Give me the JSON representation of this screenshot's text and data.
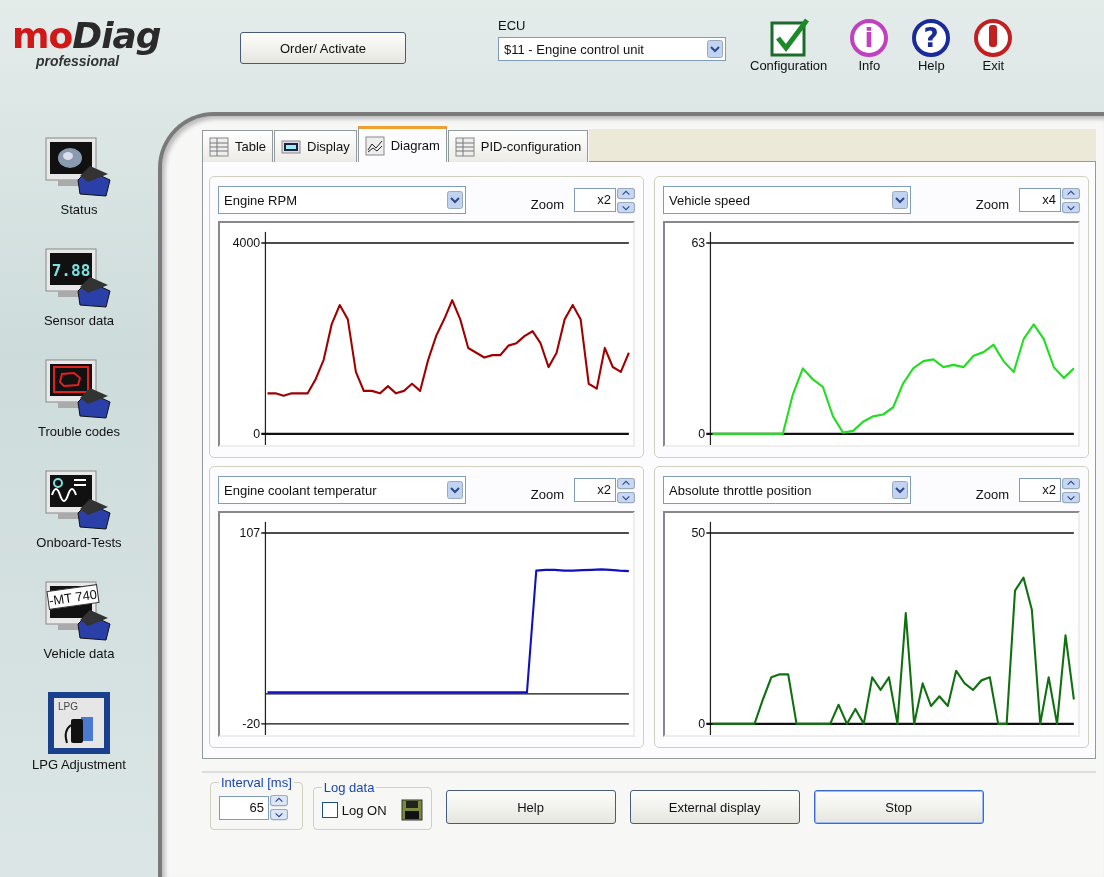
{
  "logo": {
    "brand_a": "mo",
    "brand_b": "Diag",
    "subtitle": "professional"
  },
  "header": {
    "order_button": "Order/ Activate",
    "ecu_label": "ECU",
    "ecu_value": "$11 - Engine control unit",
    "tools": [
      {
        "kind": "config",
        "label": "Configuration"
      },
      {
        "kind": "info",
        "label": "Info",
        "glyph": "i"
      },
      {
        "kind": "help",
        "label": "Help",
        "glyph": "?"
      },
      {
        "kind": "exit",
        "label": "Exit"
      }
    ]
  },
  "sidebar": {
    "items": [
      {
        "kind": "status",
        "label": "Status"
      },
      {
        "kind": "sensor",
        "label": "Sensor data",
        "screen_text": "7.88"
      },
      {
        "kind": "trouble",
        "label": "Trouble codes"
      },
      {
        "kind": "onboard",
        "label": "Onboard-Tests"
      },
      {
        "kind": "vehicle",
        "label": "Vehicle data",
        "screen_text": "-MT 740"
      },
      {
        "kind": "lpg",
        "label": "LPG Adjustment",
        "screen_text": "LPG"
      }
    ]
  },
  "tabs": [
    {
      "kind": "table",
      "label": "Table",
      "selected": false
    },
    {
      "kind": "display",
      "label": "Display",
      "selected": false
    },
    {
      "kind": "diagram",
      "label": "Diagram",
      "selected": true
    },
    {
      "kind": "table",
      "label": "PID-configuration",
      "selected": false
    }
  ],
  "diagrams": [
    {
      "parameter": "Engine RPM",
      "zoom_label": "Zoom",
      "zoom": "x2",
      "chart_data": {
        "type": "line",
        "ylim": [
          0,
          4000
        ],
        "yticks": [
          0,
          4000
        ],
        "series": [
          {
            "color": "#a00000",
            "values": [
              850,
              850,
              800,
              850,
              850,
              850,
              1150,
              1550,
              2300,
              2700,
              2400,
              1300,
              900,
              900,
              850,
              1000,
              850,
              900,
              1050,
              900,
              1550,
              2050,
              2400,
              2800,
              2400,
              1800,
              1700,
              1600,
              1650,
              1650,
              1850,
              1900,
              2050,
              2150,
              1900,
              1400,
              1700,
              2400,
              2700,
              2400,
              1050,
              950,
              1800,
              1400,
              1300,
              1700
            ]
          }
        ]
      }
    },
    {
      "parameter": "Vehicle speed",
      "zoom_label": "Zoom",
      "zoom": "x4",
      "chart_data": {
        "type": "line",
        "ylim": [
          0,
          63
        ],
        "yticks": [
          0,
          63
        ],
        "series": [
          {
            "color": "#22dd22",
            "values": [
              0,
              0,
              0,
              0,
              0,
              0,
              0,
              0,
              13,
              21.6,
              18,
              15.5,
              5.8,
              0.4,
              1,
              4,
              5.8,
              6.4,
              8.8,
              16.7,
              21.6,
              24,
              24.6,
              22,
              22.8,
              22,
              25.8,
              27,
              29.4,
              24,
              20.4,
              31.3,
              36.1,
              31.3,
              22,
              18.5,
              21.6
            ]
          }
        ]
      }
    },
    {
      "parameter": "Engine coolant temperatur",
      "zoom_label": "Zoom",
      "zoom": "x2",
      "chart_data": {
        "type": "line",
        "ylim": [
          -20,
          107
        ],
        "yticks": [
          -20,
          107
        ],
        "series": [
          {
            "color": "#1010c0",
            "values": [
              1,
              1,
              1,
              1,
              1,
              1,
              1,
              1,
              1,
              1,
              1,
              1,
              1,
              1,
              1,
              1,
              1,
              1,
              1,
              1,
              1,
              1,
              1,
              1,
              1,
              1,
              1,
              1,
              1,
              82,
              82.5,
              82.5,
              82,
              82,
              82.3,
              82.5,
              82.8,
              82.5,
              82,
              81.6
            ]
          }
        ]
      }
    },
    {
      "parameter": "Absolute throttle position",
      "zoom_label": "Zoom",
      "zoom": "x2",
      "chart_data": {
        "type": "line",
        "ylim": [
          0,
          50
        ],
        "yticks": [
          0,
          50
        ],
        "series": [
          {
            "color": "#107010",
            "values": [
              0,
              0,
              0,
              0,
              0,
              0,
              6.4,
              12.2,
              13,
              13,
              0,
              0,
              0,
              0,
              0,
              5,
              0,
              3.9,
              0,
              12.2,
              8.9,
              12.2,
              0,
              29,
              0,
              10.6,
              4.7,
              7.2,
              4.7,
              13.9,
              10.6,
              8.9,
              11.4,
              12.2,
              0,
              0,
              34.9,
              38.3,
              29.9,
              0,
              12.2,
              0,
              23.2,
              6.4
            ]
          }
        ]
      }
    }
  ],
  "interval": {
    "legend": "Interval [ms]",
    "value": "65"
  },
  "log": {
    "legend": "Log data",
    "label": "Log ON",
    "checked": false
  },
  "buttons": [
    {
      "label": "Help",
      "focused": false
    },
    {
      "label": "External display",
      "focused": false
    },
    {
      "label": "Stop",
      "focused": true
    }
  ]
}
